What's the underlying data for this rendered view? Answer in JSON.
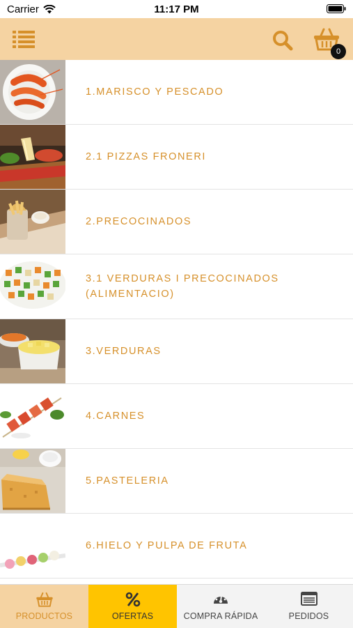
{
  "status_bar": {
    "carrier": "Carrier",
    "time": "11:17 PM"
  },
  "header": {
    "cart_count": "0"
  },
  "colors": {
    "header_bg": "#f5d3a2",
    "accent": "#d6902a",
    "active_tab_bg": "#f5d3a2",
    "offer_tab_bg": "#ffc400"
  },
  "categories": [
    {
      "label": "1.MARISCO Y PESCADO",
      "icon": "seafood-photo"
    },
    {
      "label": "2.1 PIZZAS FRONERI",
      "icon": "pizza-photo"
    },
    {
      "label": "2.PRECOCINADOS",
      "icon": "precooked-photo"
    },
    {
      "label": "3.1 VERDURAS I PRECOCINADOS (ALIMENTACIO)",
      "icon": "mixed-vegetables-photo"
    },
    {
      "label": "3.VERDURAS",
      "icon": "vegetables-photo"
    },
    {
      "label": "4.CARNES",
      "icon": "meat-skewer-photo"
    },
    {
      "label": "5.PASTELERIA",
      "icon": "pastry-photo"
    },
    {
      "label": "6.HIELO Y PULPA DE FRUTA",
      "icon": "ice-cream-photo"
    }
  ],
  "tabs": [
    {
      "label": "PRODUCTOS",
      "icon": "basket-icon",
      "active": true
    },
    {
      "label": "OFERTAS",
      "icon": "percent-icon"
    },
    {
      "label": "COMPRA RÁPIDA",
      "icon": "speedometer-icon"
    },
    {
      "label": "PEDIDOS",
      "icon": "orders-list-icon"
    }
  ]
}
